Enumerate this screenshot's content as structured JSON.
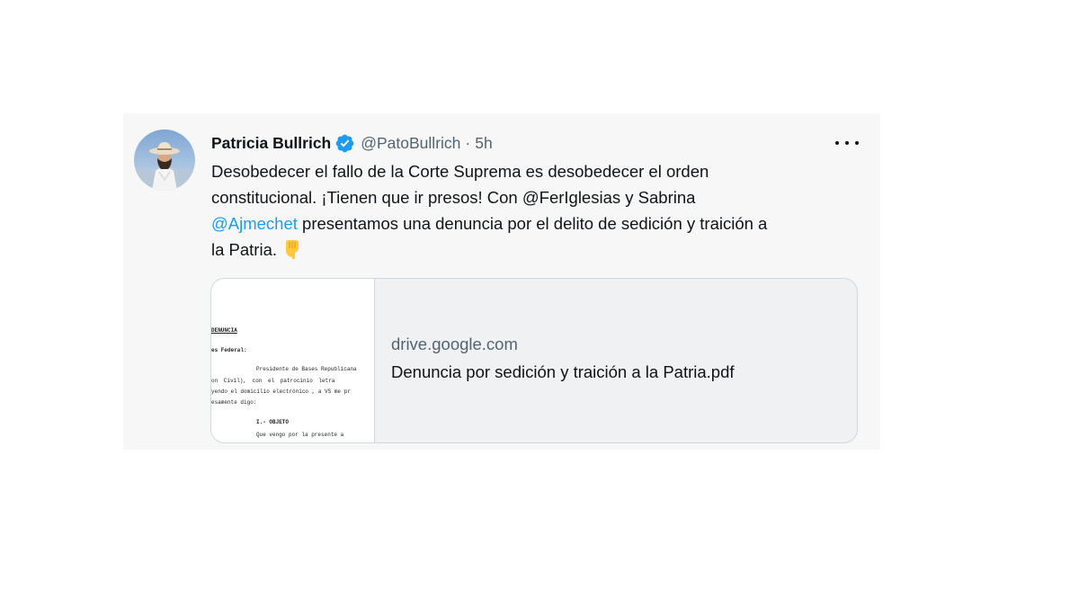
{
  "tweet": {
    "author_name": "Patricia Bullrich",
    "handle": "@PatoBullrich",
    "separator": "·",
    "time": "5h",
    "verified_icon": "verified-badge-icon",
    "more_icon": "more-horizontal-icon",
    "text": {
      "line1": "Desobedecer el fallo de la Corte Suprema es desobedecer el orden",
      "line2_pre": "constitucional. ¡Tienen que ir presos! Con ",
      "mention1": "@FerIglesias",
      "line2_post": " y Sabrina",
      "mention2": "@Ajmechet",
      "line3_post": " presentamos una denuncia por el delito de sedición y traición a",
      "line4": "la Patria.",
      "emoji": "backhand-index-pointing-down-icon"
    },
    "card": {
      "domain": "drive.google.com",
      "title": "Denuncia por sedición y traición a la Patria.pdf",
      "thumbnail": {
        "heading": "DENUNCIA",
        "addressee": "es Federal:",
        "line1": "Presidente de Bases Republicana",
        "line2": "on Civil), con el patrocinio letra",
        "line3": "yendo el domicilio electrónico , a VS me pr",
        "line4": "esamente digo:",
        "section": "I.- OBJETO",
        "line5": "Que vengo por la presente a"
      }
    }
  },
  "colors": {
    "link": "#1d9bf0",
    "verified": "#1d9bf0",
    "secondary_text": "#536471",
    "primary_text": "#0f1419",
    "border": "#cfd9de"
  }
}
